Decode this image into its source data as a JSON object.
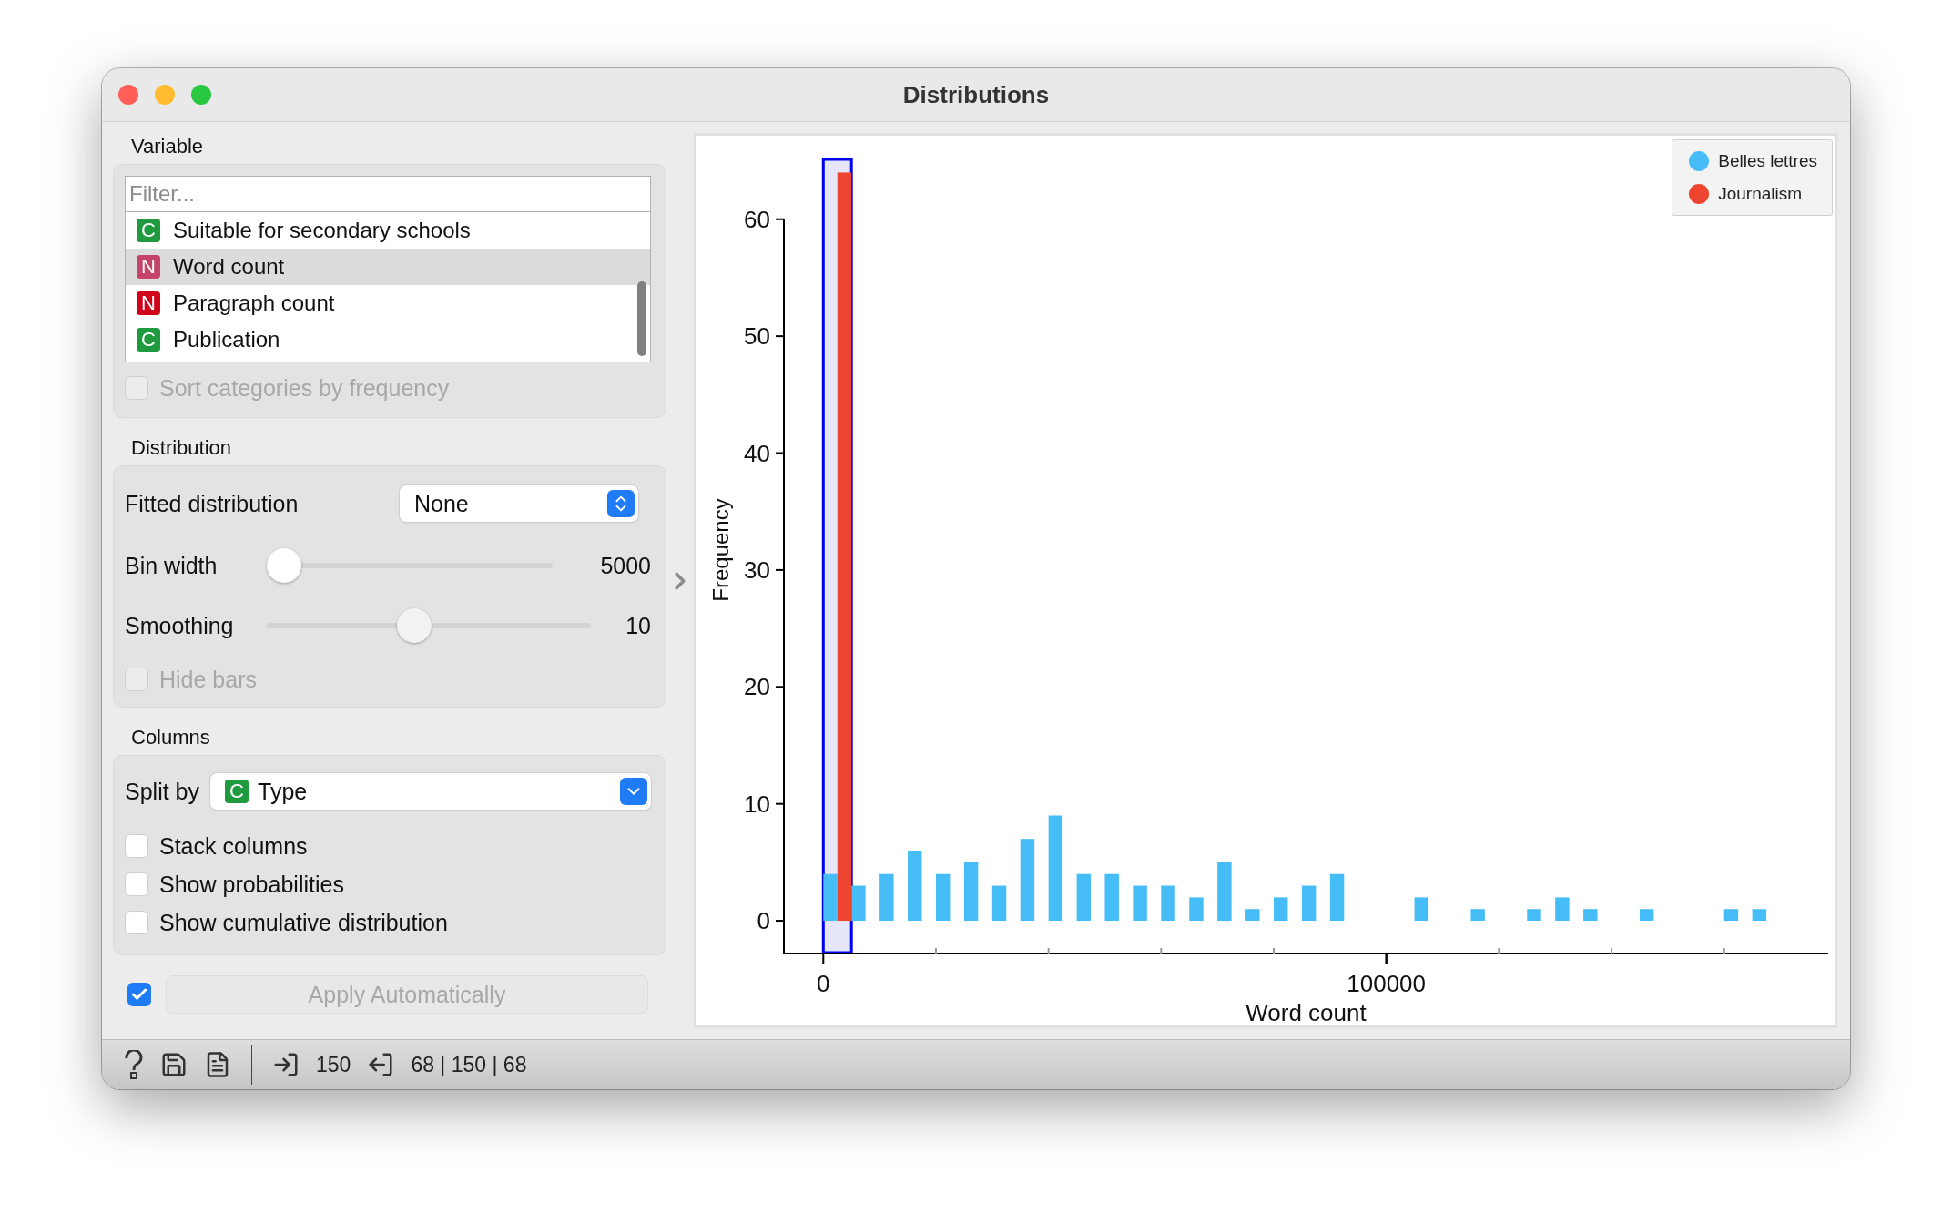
{
  "window": {
    "title": "Distributions"
  },
  "variable": {
    "heading": "Variable",
    "filter": {
      "placeholder": "Filter..."
    },
    "items": [
      {
        "badge": "C",
        "color": "#1f9a3f",
        "label": "Suitable for secondary schools",
        "selected": false
      },
      {
        "badge": "N",
        "color": "#c6446a",
        "label": "Word count",
        "selected": true
      },
      {
        "badge": "N",
        "color": "#d0021b",
        "label": "Paragraph count",
        "selected": false
      },
      {
        "badge": "C",
        "color": "#1f9a3f",
        "label": "Publication",
        "selected": false
      }
    ],
    "sort_by_frequency": {
      "label": "Sort categories by frequency",
      "checked": false,
      "disabled": true
    }
  },
  "distribution": {
    "heading": "Distribution",
    "fitted": {
      "label": "Fitted distribution",
      "value": "None"
    },
    "bin_width": {
      "label": "Bin width",
      "level": 0.0,
      "reading": "5000"
    },
    "smoothing": {
      "label": "Smoothing",
      "level": 0.45,
      "reading": "10",
      "disabled": true
    },
    "hide_bars": {
      "label": "Hide bars",
      "checked": false,
      "disabled": true
    }
  },
  "columns": {
    "heading": "Columns",
    "split_by": {
      "label": "Split by",
      "badge": "C",
      "value": "Type"
    },
    "options": [
      {
        "label": "Stack columns",
        "checked": false
      },
      {
        "label": "Show probabilities",
        "checked": false
      },
      {
        "label": "Show cumulative distribution",
        "checked": false
      }
    ]
  },
  "apply": {
    "checked": true,
    "label": "Apply Automatically",
    "disabled": true
  },
  "plot": {
    "chart_data": {
      "type": "bar",
      "xlabel": "Word count",
      "ylabel": "Frequency",
      "x": [
        2500,
        7500,
        12500,
        17500,
        22500,
        27500,
        32500,
        37500,
        42500,
        47500,
        52500,
        57500,
        62500,
        67500,
        72500,
        77500,
        82500,
        87500,
        92500,
        97500,
        102500,
        107500,
        112500,
        117500,
        122500,
        127500,
        132500,
        137500,
        142500,
        147500,
        152500,
        157500,
        162500,
        167500
      ],
      "series": [
        {
          "name": "Belles lettres",
          "color": "#47bdf7",
          "values": [
            4,
            3,
            4,
            6,
            4,
            5,
            3,
            7,
            9,
            4,
            4,
            3,
            3,
            2,
            5,
            1,
            2,
            3,
            4,
            0,
            0,
            2,
            0,
            1,
            0,
            1,
            2,
            1,
            0,
            1,
            0,
            0,
            1,
            1
          ]
        },
        {
          "name": "Journalism",
          "color": "#ee4530",
          "values": [
            64,
            0,
            0,
            0,
            0,
            0,
            0,
            0,
            0,
            0,
            0,
            0,
            0,
            0,
            0,
            0,
            0,
            0,
            0,
            0,
            0,
            0,
            0,
            0,
            0,
            0,
            0,
            0,
            0,
            0,
            0,
            0,
            0,
            0
          ]
        }
      ],
      "xlim": [
        -7000,
        178000
      ],
      "ylim": [
        -2.8,
        65.2
      ],
      "xticks": [
        0,
        100000
      ],
      "yticks": [
        0,
        10,
        20,
        30,
        40,
        50,
        60
      ],
      "bands": [
        {
          "axis": "x",
          "from": 0,
          "to": 5000
        }
      ]
    }
  },
  "status_bar": {
    "input_count": "150",
    "output_count": "68 | 150 | 68"
  }
}
